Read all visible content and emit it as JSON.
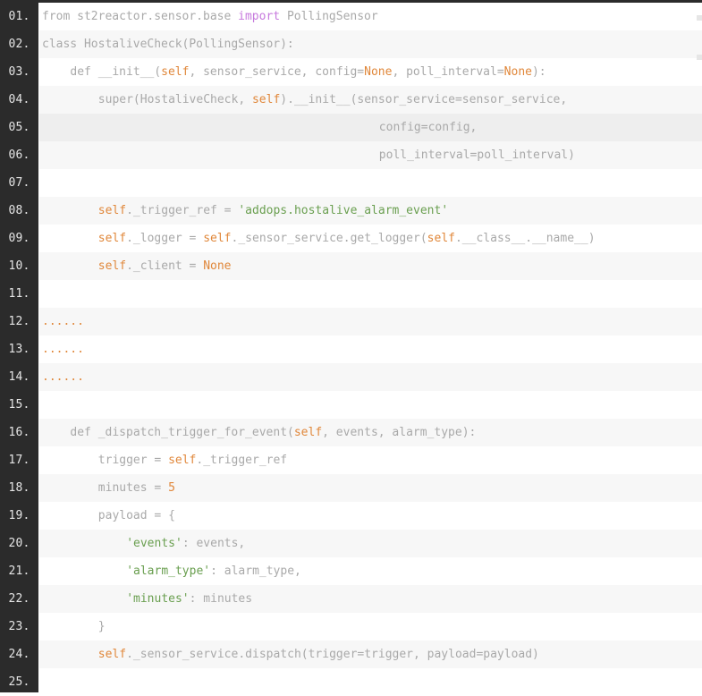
{
  "editor": {
    "lines": [
      {
        "num": "01.",
        "indent": 0,
        "tokens": [
          {
            "t": "from st2reactor.sensor.base ",
            "c": "plain"
          },
          {
            "t": "import",
            "c": "kw"
          },
          {
            "t": " PollingSensor",
            "c": "plain"
          }
        ]
      },
      {
        "num": "02.",
        "indent": 0,
        "tokens": [
          {
            "t": "class HostaliveCheck(PollingSensor):",
            "c": "plain"
          }
        ]
      },
      {
        "num": "03.",
        "indent": 4,
        "tokens": [
          {
            "t": "def __init__(",
            "c": "plain"
          },
          {
            "t": "self",
            "c": "self"
          },
          {
            "t": ", sensor_service, config=",
            "c": "plain"
          },
          {
            "t": "None",
            "c": "none"
          },
          {
            "t": ", poll_interval=",
            "c": "plain"
          },
          {
            "t": "None",
            "c": "none"
          },
          {
            "t": "):",
            "c": "plain"
          }
        ]
      },
      {
        "num": "04.",
        "indent": 8,
        "tokens": [
          {
            "t": "super(HostaliveCheck, ",
            "c": "plain"
          },
          {
            "t": "self",
            "c": "self"
          },
          {
            "t": ").__init__(sensor_service=sensor_service,",
            "c": "plain"
          }
        ]
      },
      {
        "num": "05.",
        "indent": 48,
        "tokens": [
          {
            "t": "config=config,",
            "c": "plain"
          }
        ]
      },
      {
        "num": "06.",
        "indent": 48,
        "tokens": [
          {
            "t": "poll_interval=poll_interval)",
            "c": "plain"
          }
        ]
      },
      {
        "num": "07.",
        "indent": 0,
        "tokens": []
      },
      {
        "num": "08.",
        "indent": 8,
        "tokens": [
          {
            "t": "self",
            "c": "self"
          },
          {
            "t": "._trigger_ref = ",
            "c": "plain"
          },
          {
            "t": "'addops.hostalive_alarm_event'",
            "c": "str"
          }
        ]
      },
      {
        "num": "09.",
        "indent": 8,
        "tokens": [
          {
            "t": "self",
            "c": "self"
          },
          {
            "t": "._logger = ",
            "c": "plain"
          },
          {
            "t": "self",
            "c": "self"
          },
          {
            "t": "._sensor_service.get_logger(",
            "c": "plain"
          },
          {
            "t": "self",
            "c": "self"
          },
          {
            "t": ".__class__.__name__)",
            "c": "plain"
          }
        ]
      },
      {
        "num": "10.",
        "indent": 8,
        "tokens": [
          {
            "t": "self",
            "c": "self"
          },
          {
            "t": "._client = ",
            "c": "plain"
          },
          {
            "t": "None",
            "c": "none"
          }
        ]
      },
      {
        "num": "11.",
        "indent": 0,
        "tokens": []
      },
      {
        "num": "12.",
        "indent": 0,
        "tokens": [
          {
            "t": "......",
            "c": "dots"
          }
        ]
      },
      {
        "num": "13.",
        "indent": 0,
        "tokens": [
          {
            "t": "......",
            "c": "dots"
          }
        ]
      },
      {
        "num": "14.",
        "indent": 0,
        "tokens": [
          {
            "t": "......",
            "c": "dots"
          }
        ]
      },
      {
        "num": "15.",
        "indent": 0,
        "tokens": []
      },
      {
        "num": "16.",
        "indent": 4,
        "tokens": [
          {
            "t": "def _dispatch_trigger_for_event(",
            "c": "plain"
          },
          {
            "t": "self",
            "c": "self"
          },
          {
            "t": ", events, alarm_type):",
            "c": "plain"
          }
        ]
      },
      {
        "num": "17.",
        "indent": 8,
        "tokens": [
          {
            "t": "trigger = ",
            "c": "plain"
          },
          {
            "t": "self",
            "c": "self"
          },
          {
            "t": "._trigger_ref",
            "c": "plain"
          }
        ]
      },
      {
        "num": "18.",
        "indent": 8,
        "tokens": [
          {
            "t": "minutes = ",
            "c": "plain"
          },
          {
            "t": "5",
            "c": "num"
          }
        ]
      },
      {
        "num": "19.",
        "indent": 8,
        "tokens": [
          {
            "t": "payload = {",
            "c": "plain"
          }
        ]
      },
      {
        "num": "20.",
        "indent": 12,
        "tokens": [
          {
            "t": "'events'",
            "c": "str"
          },
          {
            "t": ": events,",
            "c": "plain"
          }
        ]
      },
      {
        "num": "21.",
        "indent": 12,
        "tokens": [
          {
            "t": "'alarm_type'",
            "c": "str"
          },
          {
            "t": ": alarm_type,",
            "c": "plain"
          }
        ]
      },
      {
        "num": "22.",
        "indent": 12,
        "tokens": [
          {
            "t": "'minutes'",
            "c": "str"
          },
          {
            "t": ": minutes",
            "c": "plain"
          }
        ]
      },
      {
        "num": "23.",
        "indent": 8,
        "tokens": [
          {
            "t": "}",
            "c": "plain"
          }
        ]
      },
      {
        "num": "24.",
        "indent": 8,
        "tokens": [
          {
            "t": "self",
            "c": "self"
          },
          {
            "t": "._sensor_service.dispatch(trigger=trigger, payload=payload)",
            "c": "plain"
          }
        ]
      },
      {
        "num": "25.",
        "indent": 0,
        "tokens": []
      }
    ]
  },
  "colors": {
    "gutter": "#2b2b2b",
    "keyword": "#c678dd",
    "self": "#e0873a",
    "string": "#6a9f50",
    "text": "#a9a9a9"
  }
}
